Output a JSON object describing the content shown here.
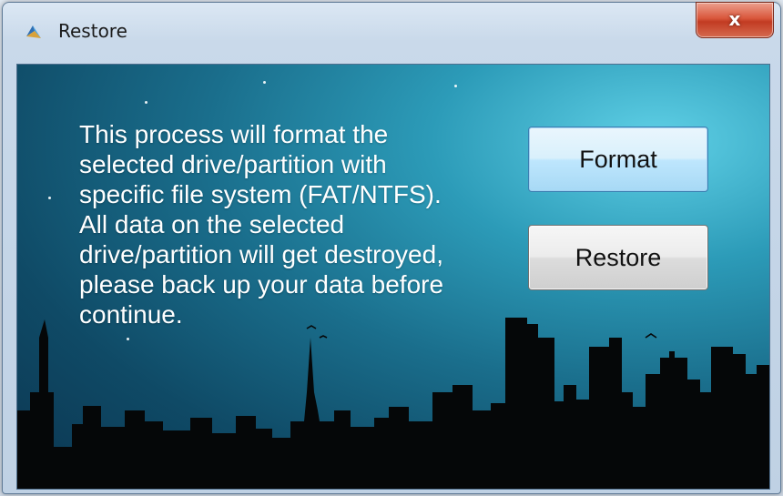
{
  "window": {
    "title": "Restore",
    "close_label": "x"
  },
  "message": {
    "lines": [
      "This process will format the",
      "selected drive/partition with",
      "specific file system (FAT/NTFS).",
      "All data on the selected",
      "drive/partition will get destroyed,",
      "please back up your data before",
      "continue."
    ]
  },
  "buttons": {
    "format_label": "Format",
    "restore_label": "Restore"
  },
  "colors": {
    "sky_top": "#5fd0e6",
    "sky_dark": "#0b3550",
    "close_red": "#c23b22",
    "focus_blue": "#bee6fd"
  }
}
